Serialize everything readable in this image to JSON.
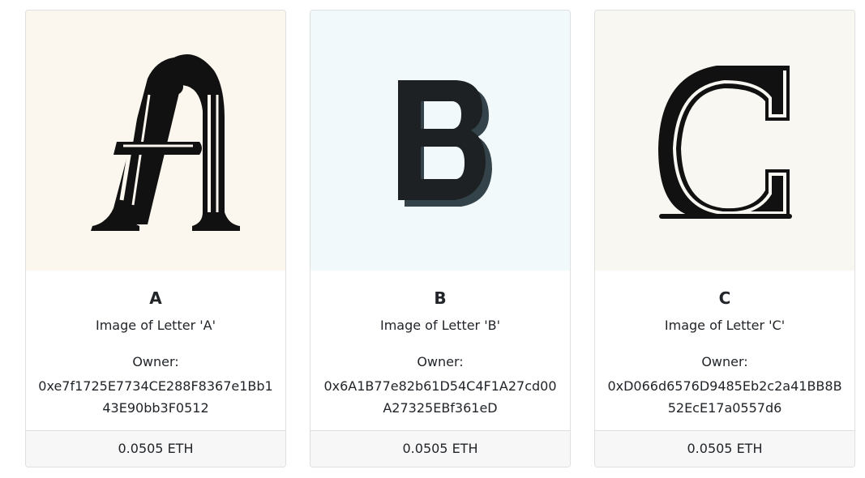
{
  "cards": [
    {
      "title": "A",
      "description": "Image of Letter 'A'",
      "owner_label": "Owner:",
      "owner_address": "0xe7f1725E7734CE288F8367e1Bb143E90bb3F0512",
      "price": "0.0505 ETH",
      "image_background": "#fbf7ee",
      "image_icon": "letter-a-image"
    },
    {
      "title": "B",
      "description": "Image of Letter 'B'",
      "owner_label": "Owner:",
      "owner_address": "0x6A1B77e82b61D54C4F1A27cd00A27325EBf361eD",
      "price": "0.0505 ETH",
      "image_background": "#f1f9fb",
      "image_icon": "letter-b-image"
    },
    {
      "title": "C",
      "description": "Image of Letter 'C'",
      "owner_label": "Owner:",
      "owner_address": "0xD066d6576D9485Eb2c2a41BB8B52EcE17a0557d6",
      "price": "0.0505 ETH",
      "image_background": "#f8f7f2",
      "image_icon": "letter-c-image"
    }
  ]
}
